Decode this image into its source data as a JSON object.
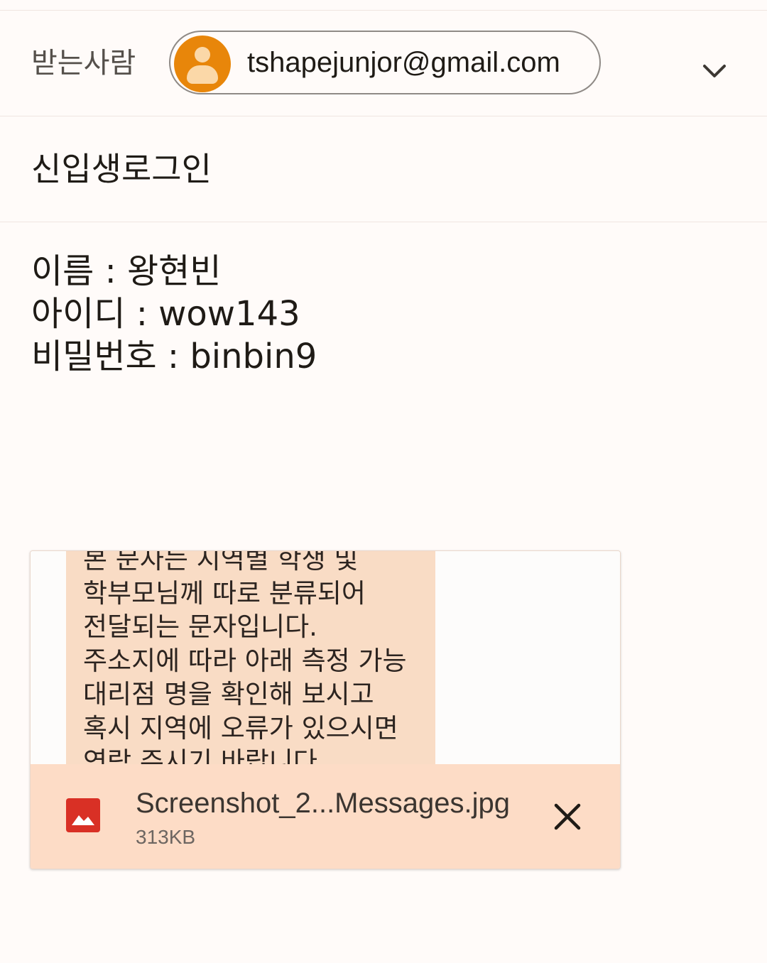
{
  "compose": {
    "to_label": "받는사람",
    "recipient": {
      "email": "tshapejunjor@gmail.com",
      "avatar_icon": "person-icon",
      "avatar_color": "#e8860a"
    },
    "expand_icon": "chevron-down-icon",
    "subject": "신입생로그인",
    "body_lines": [
      "이름 : 왕현빈",
      "아이디 : wow143",
      "비밀번호 : binbin9"
    ]
  },
  "attachment": {
    "preview_lines": [
      "본 문자는 지역별 학생 및",
      "학부모님께 따로 분류되어",
      "전달되는 문자입니다.",
      "주소지에 따라 아래 측정 가능",
      "대리점 명을 확인해 보시고",
      "혹시 지역에 오류가 있으시면",
      "연락 주시기 바랍니다"
    ],
    "file_name": "Screenshot_2...Messages.jpg",
    "file_size": "313KB",
    "file_icon": "image-icon",
    "file_icon_color": "#d93025",
    "remove_icon": "close-icon"
  }
}
